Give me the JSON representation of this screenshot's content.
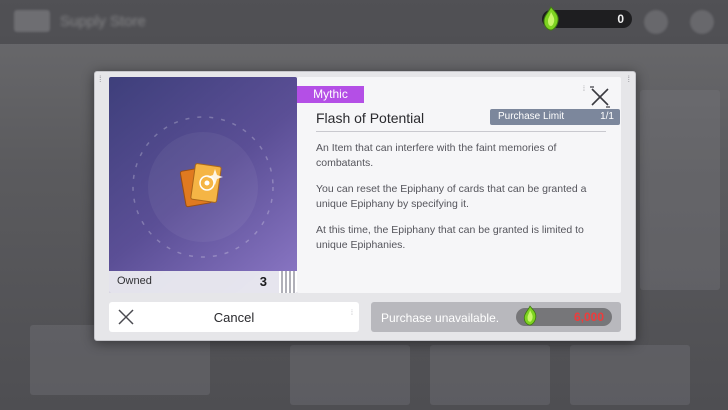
{
  "background": {
    "screen_title": "Supply Store"
  },
  "currency": {
    "icon": "green-gem-icon",
    "amount": "0"
  },
  "item": {
    "rarity": "Mythic",
    "name": "Flash of Potential",
    "icon": "card-stack-icon",
    "owned_label": "Owned",
    "owned_count": "3",
    "purchase_limit_label": "Purchase Limit",
    "purchase_limit_value": "1/1",
    "description": [
      "An Item that can interfere with the faint memories of combatants.",
      "You can reset the Epiphany of cards that can be granted a unique Epiphany by specifying it.",
      "At this time, the Epiphany that can be granted is limited to unique Epiphanies."
    ]
  },
  "buttons": {
    "cancel_label": "Cancel",
    "purchase_label": "Purchase unavailable.",
    "price": "6,000",
    "price_icon": "green-gem-icon"
  },
  "colors": {
    "rarity_mythic": "#b44fe6",
    "price_insufficient": "#ef3b3b",
    "limit_badge": "#7c879c"
  }
}
